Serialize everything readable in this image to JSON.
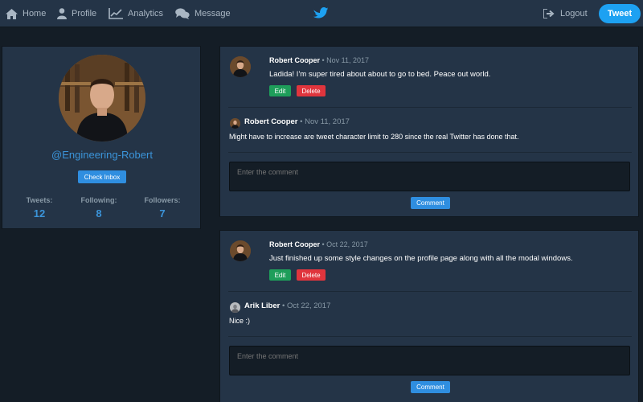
{
  "nav": {
    "home": "Home",
    "profile": "Profile",
    "analytics": "Analytics",
    "message": "Message",
    "logout": "Logout",
    "tweet": "Tweet"
  },
  "profile": {
    "handle": "@Engineering-Robert",
    "inbox_label": "Check Inbox",
    "stats": [
      {
        "label": "Tweets:",
        "value": "12"
      },
      {
        "label": "Following:",
        "value": "8"
      },
      {
        "label": "Followers:",
        "value": "7"
      }
    ]
  },
  "tweets": [
    {
      "author": "Robert Cooper",
      "date": "• Nov 11, 2017",
      "text": "Ladida! I'm super tired about about to go to bed. Peace out world.",
      "edit_label": "Edit",
      "delete_label": "Delete",
      "comments": [
        {
          "author": "Robert Cooper",
          "date": "• Nov 11, 2017",
          "text": "Might have to increase are tweet character limit to 280 since the real Twitter has done that."
        }
      ],
      "comment_placeholder": "Enter the comment",
      "comment_button": "Comment"
    },
    {
      "author": "Robert Cooper",
      "date": "• Oct 22, 2017",
      "text": "Just finished up some style changes on the profile page along with all the modal windows.",
      "edit_label": "Edit",
      "delete_label": "Delete",
      "comments": [
        {
          "author": "Arik Liber",
          "date": "• Oct 22, 2017",
          "text": "Nice :)"
        }
      ],
      "comment_placeholder": "Enter the comment",
      "comment_button": "Comment"
    }
  ],
  "colors": {
    "background": "#141d26",
    "panel": "#243447",
    "accent": "#1da1f2",
    "edit": "#1e9e5a",
    "delete": "#e0353d",
    "muted": "#8899a6"
  }
}
